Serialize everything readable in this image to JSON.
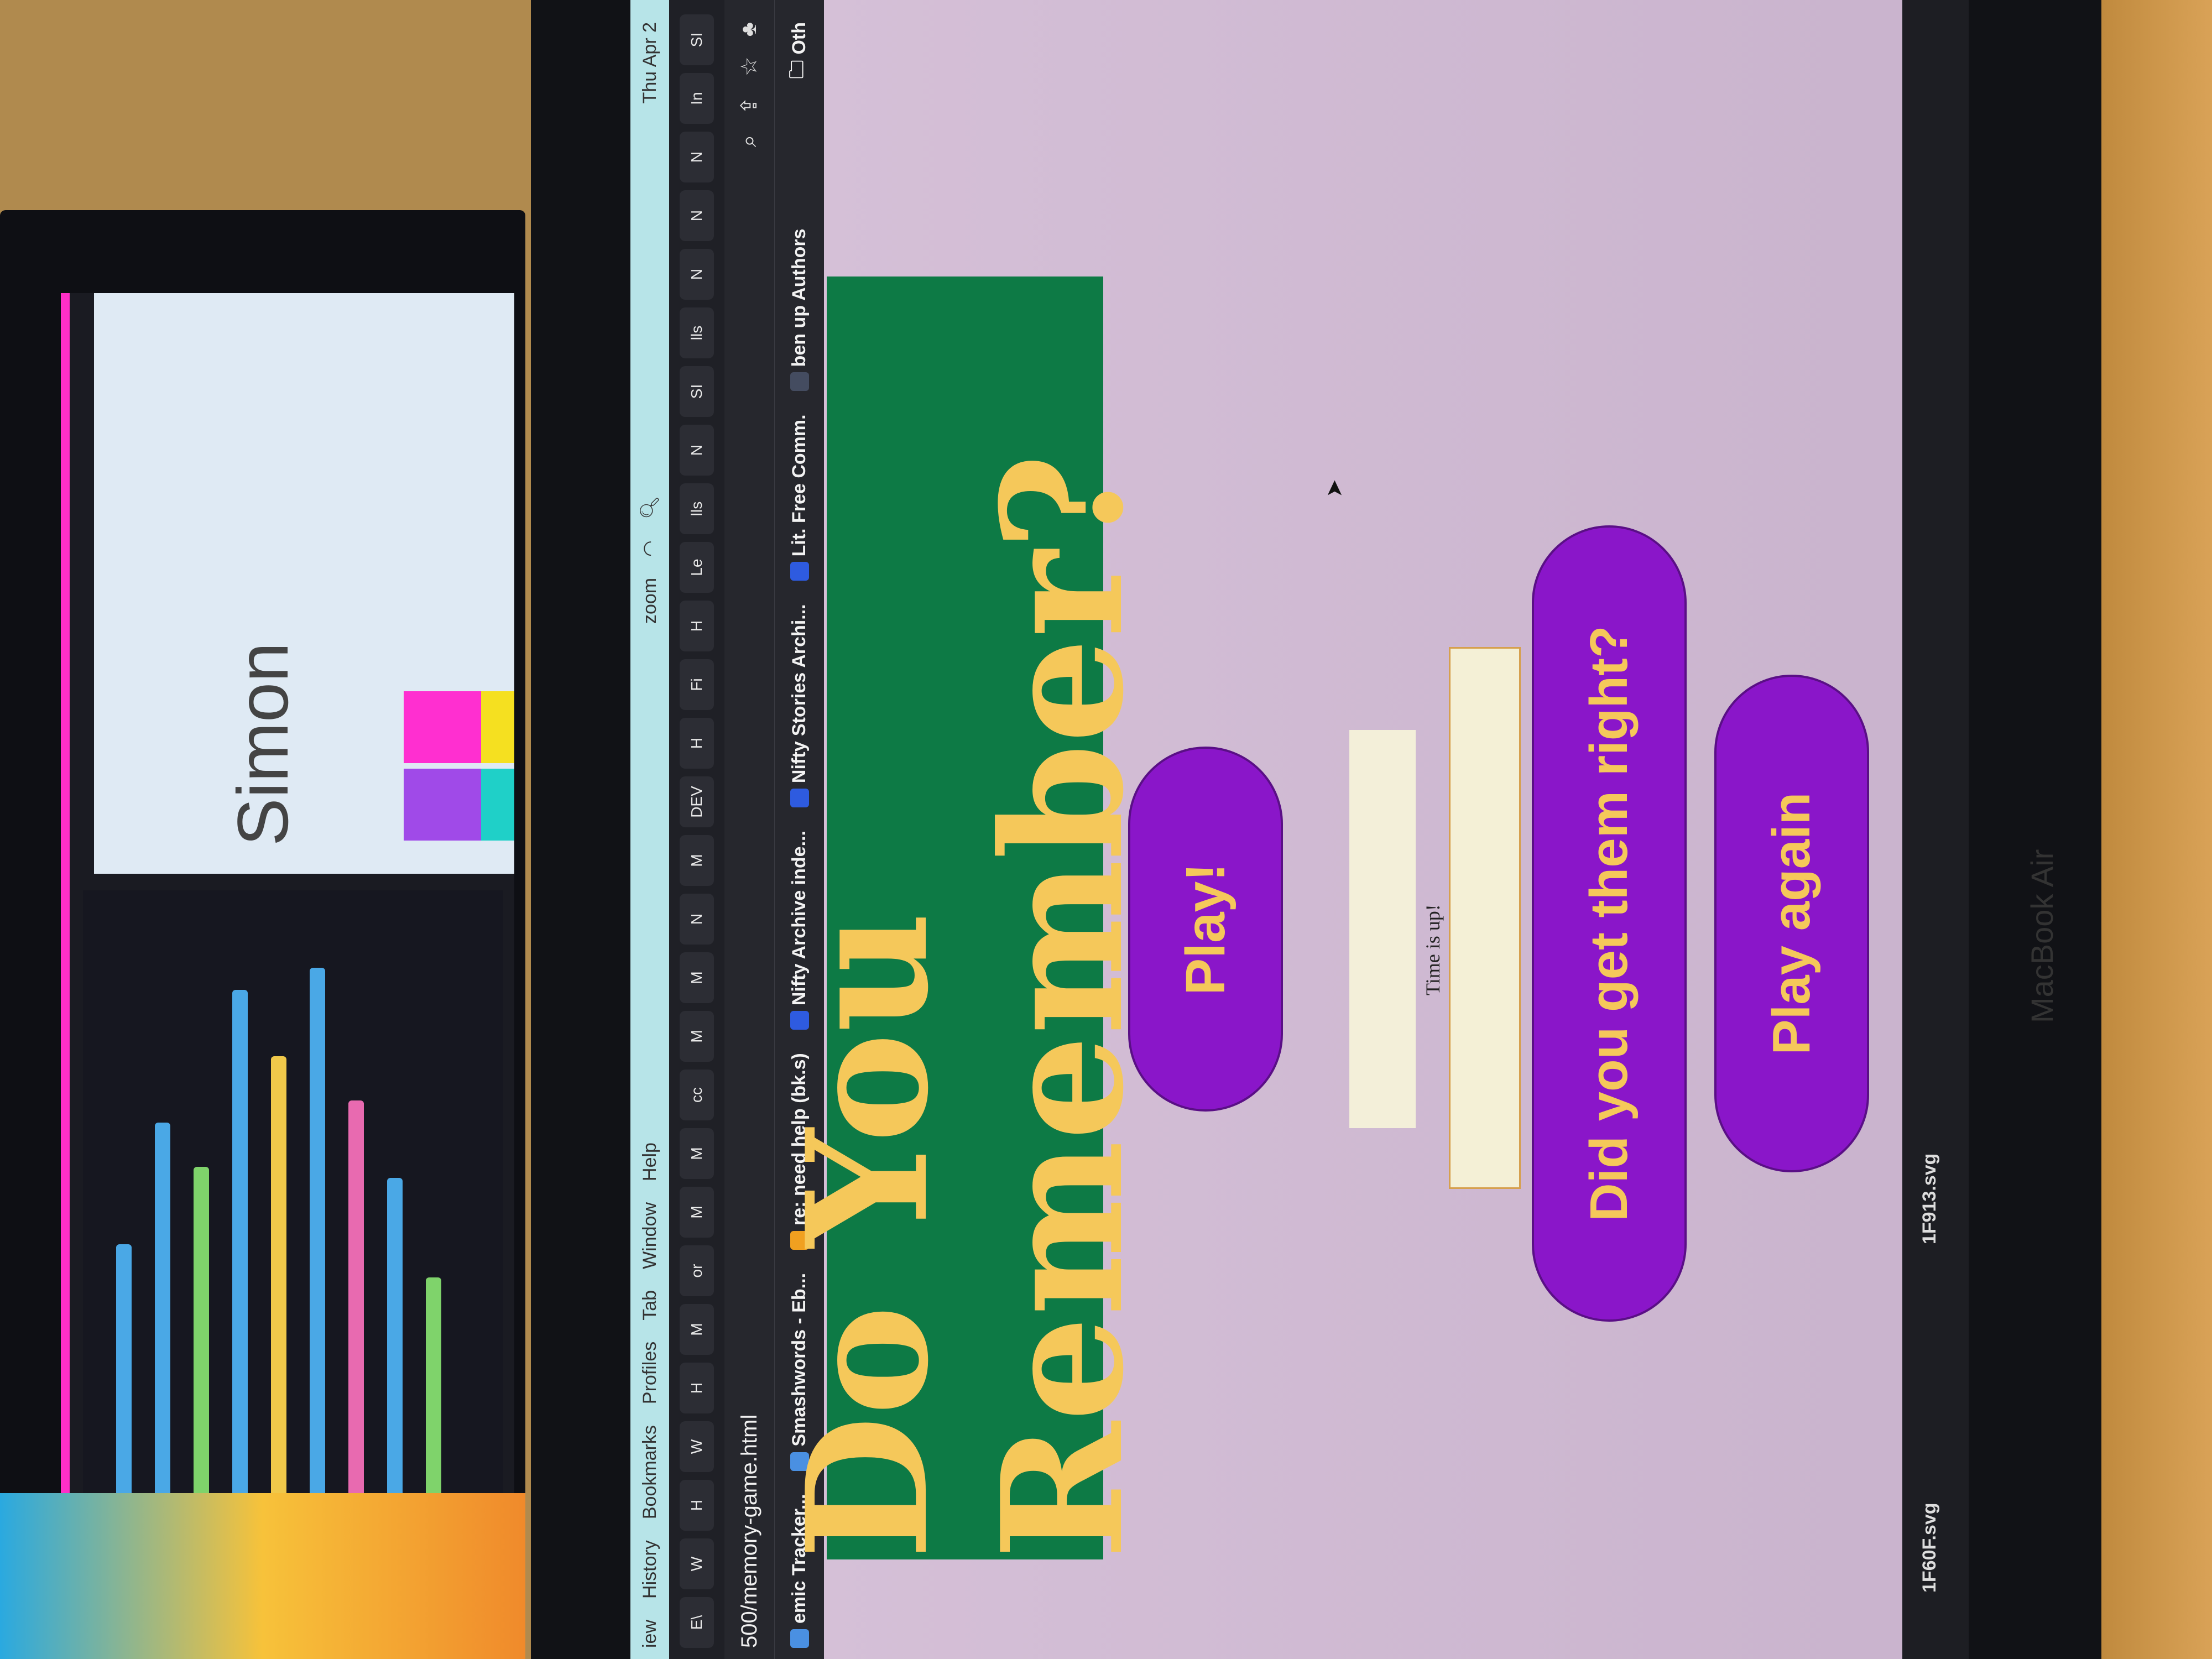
{
  "menubar": {
    "items": [
      "iew",
      "History",
      "Bookmarks",
      "Profiles",
      "Tab",
      "Window",
      "Help"
    ],
    "zoom": "zoom",
    "clock": "Thu Apr 2"
  },
  "tabs": [
    "E\\",
    "W",
    "H",
    "W",
    "H",
    "M",
    "or",
    "M",
    "M",
    "cc",
    "M",
    "M",
    "N",
    "M",
    "DEV",
    "H",
    "Fi",
    "H",
    "Le",
    "lls",
    "N",
    "SI",
    "lls",
    "N",
    "N",
    "N",
    "In",
    "SI"
  ],
  "address": {
    "url": "500/memory-game.html"
  },
  "bookmarks": [
    {
      "label": "emic Tracker...",
      "color": "#4a90e2"
    },
    {
      "label": "Smashwords - Eb...",
      "color": "#4a90e2"
    },
    {
      "label": "re: need help (bk.s)",
      "color": "#f0a020"
    },
    {
      "label": "Nifty Archive inde...",
      "color": "#2e5be0"
    },
    {
      "label": "Nifty Stories Archi...",
      "color": "#2e5be0"
    },
    {
      "label": "Lit. Free Comm.",
      "color": "#2e5be0"
    },
    {
      "label": "ben up Authors",
      "color": "#444c60"
    }
  ],
  "bookmarks_other": "Oth",
  "page": {
    "title": "Do You Remember?",
    "play_button": "Play!",
    "time_message": "Time is up!",
    "answer_value": "",
    "check_button": "Did you get them right?",
    "play_again_button": "Play again"
  },
  "downloads": [
    "1F60F.svg",
    "1F913.svg"
  ],
  "laptop_brand": "MacBook Air",
  "second_monitor": {
    "slide_title": "Simon"
  },
  "colors": {
    "banner": "#0d7a45",
    "title_text": "#f5c85a",
    "button_fill": "#8a16c9",
    "page_bg": "#c9b2cf"
  }
}
